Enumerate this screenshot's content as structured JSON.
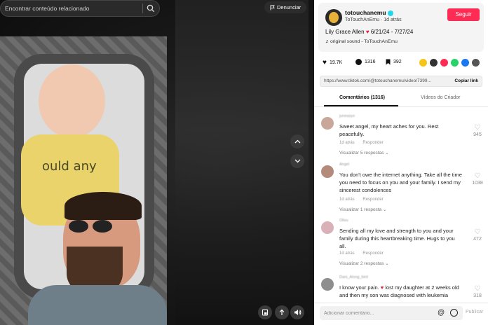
{
  "search": {
    "placeholder": "Encontrar conteúdo relacionado"
  },
  "report": {
    "label": "Denunciar"
  },
  "author": {
    "username": "totouchanemu",
    "display_name": "ToTouchAnEmu",
    "time_ago": "1d atrás",
    "follow_label": "Seguir"
  },
  "caption": {
    "before_heart": "Lily Grace Allen",
    "after_heart": "6/21/24 - 7/27/24"
  },
  "sound": {
    "label": "original sound - ToTouchAnEmu"
  },
  "stats": {
    "likes": "19.7K",
    "comments": "1316",
    "saves": "392"
  },
  "share_icons": [
    {
      "name": "embed-icon",
      "color": "#f5c518"
    },
    {
      "name": "code-icon",
      "color": "#333333"
    },
    {
      "name": "send-icon",
      "color": "#fe2c55"
    },
    {
      "name": "whatsapp-icon",
      "color": "#25d366"
    },
    {
      "name": "facebook-icon",
      "color": "#1877f2"
    },
    {
      "name": "more-share-icon",
      "color": "#555555"
    }
  ],
  "link": {
    "url": "https://www.tiktok.com/@totouchanemu/video/7399...",
    "copy_label": "Copiar link"
  },
  "tabs": [
    {
      "label": "Comentários (1316)"
    },
    {
      "label": "Vídeos do Criador"
    }
  ],
  "comments": [
    {
      "name": "juneasyo",
      "text": "Sweet angel, my heart aches for you. Rest peacefully.",
      "date": "1d atrás",
      "reply_label": "Responder",
      "replies": "Visualizar 5 respostas",
      "likes": "945",
      "avatar_color": "#c9a89a"
    },
    {
      "name": "Angel",
      "text": "You don't owe the internet anything. Take all the time you need to focus on you and your family. I send my sincerest condolences",
      "date": "1d atrás",
      "reply_label": "Responder",
      "replies": "Visualizar 1 resposta",
      "likes": "1038",
      "avatar_color": "#b48a7a"
    },
    {
      "name": "Olivu",
      "text": "Sending all my love and strength to you and your family during this heartbreaking time. Hugs to you all.",
      "date": "1d atrás",
      "reply_label": "Responder",
      "replies": "Visualizar 2 respostas",
      "likes": "472",
      "avatar_color": "#d8b2b8"
    },
    {
      "name": "Dani_Along_bird",
      "text_before": "I know your pain.",
      "text_after": "lost my daughter at 2 weeks old and then my son was diagnosed with leukemia",
      "likes": "318",
      "avatar_color": "#8e8e8e"
    }
  ],
  "comment_input": {
    "placeholder": "Adicionar comentário...",
    "post_label": "Publicar"
  },
  "video_overlay": {
    "onesie_text": "ould any"
  }
}
